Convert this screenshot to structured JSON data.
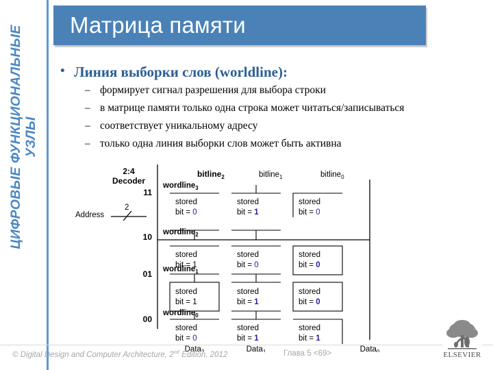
{
  "slide": {
    "title": "Матрица памяти",
    "accent_color": "#4a82b8",
    "side_band_color": "#5b9bd5",
    "bullet_color": "#2b5f96",
    "bit_value_color": "#1f1f9c"
  },
  "sidebar": {
    "line1": "ЦИФРОВЫЕ ФУНКЦИОНАЛЬНЫЕ",
    "line2": "УЗЛЫ"
  },
  "bullets": {
    "main": "Линия выборки слов (worldline):",
    "sub": [
      "формирует сигнал разрешения для выбора строки",
      "в матрице памяти только одна строка может читаться/записываться",
      "соответствует уникальному адресу",
      "только одна линия выборки слов может быть активна"
    ]
  },
  "diagram": {
    "decoder_label_line1": "2:4",
    "decoder_label_line2": "Decoder",
    "address_label": "Address",
    "address_bus_width": "2",
    "decoder_outputs": [
      "11",
      "10",
      "01",
      "00"
    ],
    "wordlines": [
      {
        "label": "wordline",
        "sub": "3",
        "active": false
      },
      {
        "label": "wordline",
        "sub": "2",
        "active": true
      },
      {
        "label": "wordline",
        "sub": "1",
        "active": false
      },
      {
        "label": "wordline",
        "sub": "0",
        "active": false
      }
    ],
    "bitlines": [
      {
        "label": "bitline",
        "sub": "2"
      },
      {
        "label": "bitline",
        "sub": "1"
      },
      {
        "label": "bitline",
        "sub": "0"
      }
    ],
    "data_labels": [
      {
        "label": "Data",
        "sub": "2"
      },
      {
        "label": "Data",
        "sub": "1"
      },
      {
        "label": "Data",
        "sub": "0"
      }
    ],
    "cell_text_line1": "stored",
    "cell_text_line2_prefix": "bit = ",
    "cells": [
      {
        "row": 3,
        "col": 2,
        "bit": "0",
        "boxed": false
      },
      {
        "row": 3,
        "col": 1,
        "bit": "1",
        "boxed": false
      },
      {
        "row": 3,
        "col": 0,
        "bit": "0",
        "boxed": false
      },
      {
        "row": 2,
        "col": 2,
        "bit": "1",
        "boxed": false
      },
      {
        "row": 2,
        "col": 1,
        "bit": "0",
        "boxed": false
      },
      {
        "row": 2,
        "col": 0,
        "bit": "0",
        "boxed": true
      },
      {
        "row": 1,
        "col": 2,
        "bit": "1",
        "boxed": true
      },
      {
        "row": 1,
        "col": 1,
        "bit": "1",
        "boxed": false
      },
      {
        "row": 1,
        "col": 0,
        "bit": "0",
        "boxed": true
      },
      {
        "row": 0,
        "col": 2,
        "bit": "0",
        "boxed": false
      },
      {
        "row": 0,
        "col": 1,
        "bit": "1",
        "boxed": false
      },
      {
        "row": 0,
        "col": 0,
        "bit": "1",
        "boxed": false
      }
    ]
  },
  "footer": {
    "copyright_symbol": "©",
    "source_pre": " Digital Design and Computer Architecture, 2",
    "source_sup": "nd",
    "source_post": " Edition, 2012",
    "page": "Глава 5 <69>",
    "publisher": "ELSEVIER"
  }
}
